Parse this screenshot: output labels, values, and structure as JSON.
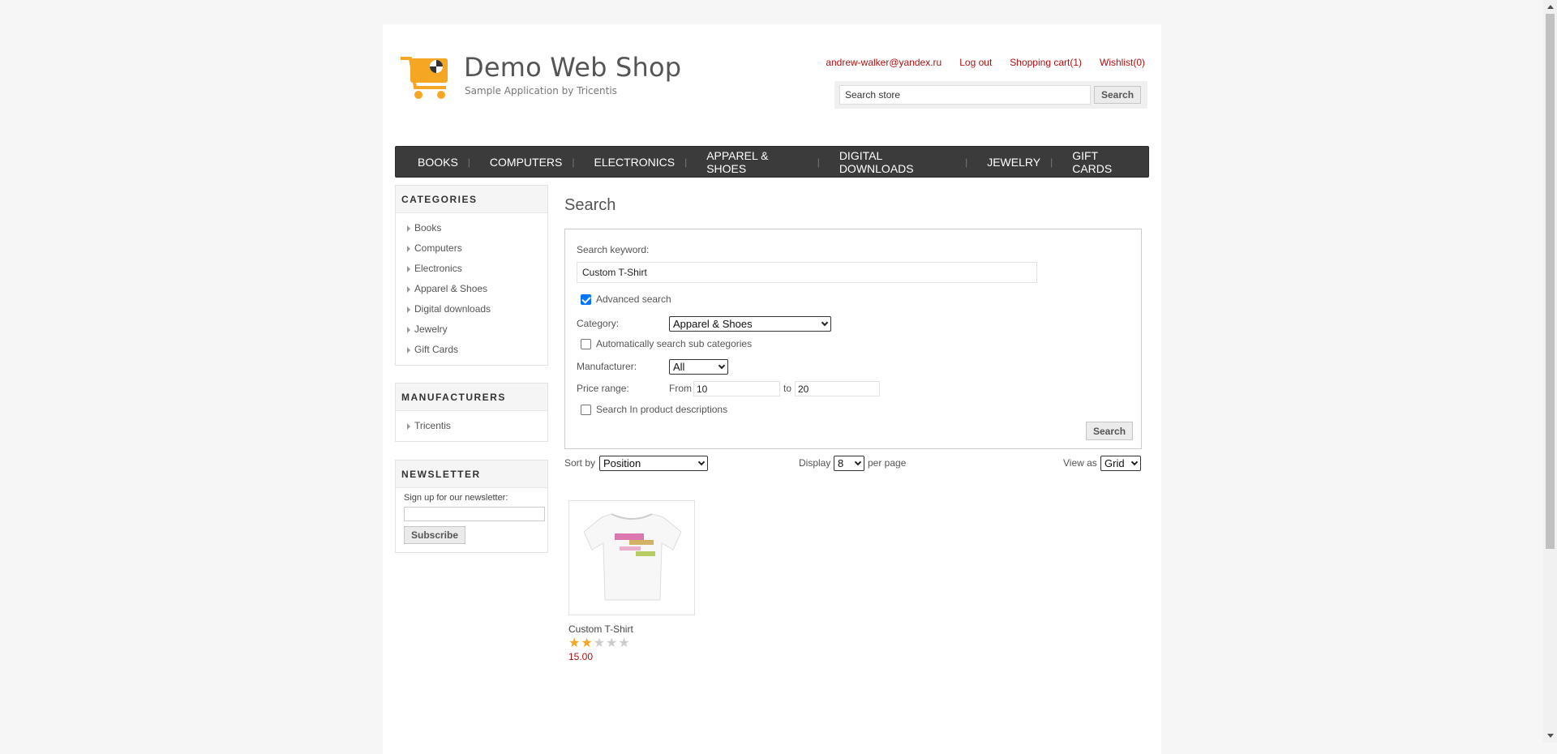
{
  "header": {
    "store_name": "Demo Web Shop",
    "store_sub": "Sample Application by Tricentis",
    "links": {
      "account": "andrew-walker@yandex.ru",
      "logout": "Log out",
      "cart": "Shopping cart(1)",
      "wishlist": "Wishlist(0)"
    },
    "search": {
      "value": "Search store",
      "button": "Search"
    }
  },
  "nav": [
    "BOOKS",
    "COMPUTERS",
    "ELECTRONICS",
    "APPAREL & SHOES",
    "DIGITAL DOWNLOADS",
    "JEWELRY",
    "GIFT CARDS"
  ],
  "categories": {
    "title": "CATEGORIES",
    "items": [
      "Books",
      "Computers",
      "Electronics",
      "Apparel & Shoes",
      "Digital downloads",
      "Jewelry",
      "Gift Cards"
    ]
  },
  "manufacturers": {
    "title": "MANUFACTURERS",
    "items": [
      "Tricentis"
    ]
  },
  "newsletter": {
    "title": "NEWSLETTER",
    "label": "Sign up for our newsletter:",
    "button": "Subscribe"
  },
  "search_page": {
    "title": "Search",
    "keyword_label": "Search keyword:",
    "keyword_value": "Custom T-Shirt",
    "advanced_label": "Advanced search",
    "advanced_checked": true,
    "category_label": "Category:",
    "category_value": "Apparel & Shoes",
    "sub_categories_label": "Automatically search sub categories",
    "manufacturer_label": "Manufacturer:",
    "manufacturer_value": "All",
    "price_label": "Price range:",
    "price_from_label": "From",
    "price_from": "10",
    "price_to_label": "to",
    "price_to": "20",
    "descriptions_label": "Search In product descriptions",
    "search_button": "Search"
  },
  "toolbar": {
    "sort_label": "Sort by",
    "sort_value": "Position",
    "display_label": "Display",
    "display_value": "8",
    "per_page": "per page",
    "view_label": "View as",
    "view_value": "Grid"
  },
  "products": [
    {
      "name": "Custom T-Shirt",
      "rating": 2,
      "rating_max": 5,
      "price": "15.00"
    }
  ],
  "colors": {
    "accent": "#b01010",
    "nav_bg": "#3b3b3b",
    "star_on": "#f5a623",
    "star_off": "#cccccc"
  }
}
